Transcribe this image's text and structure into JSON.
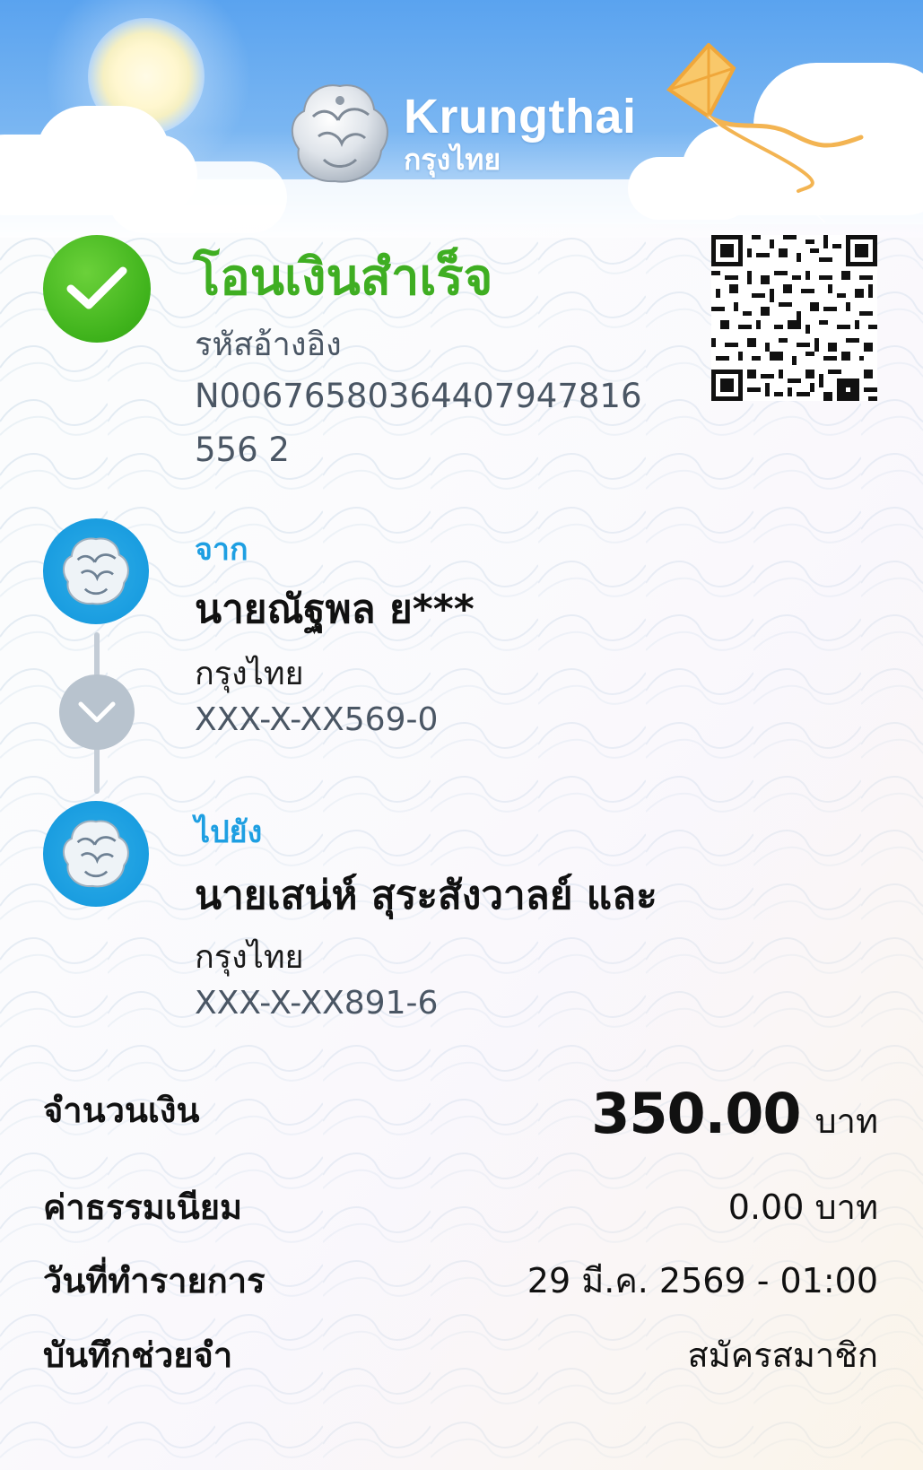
{
  "brand": {
    "name_en": "Krungthai",
    "name_th": "กรุงไทย"
  },
  "status": {
    "title": "โอนเงินสำเร็จ",
    "ref_label": "รหัสอ้างอิง",
    "ref_value": "N00676580364407947816556 2"
  },
  "from": {
    "tag": "จาก",
    "name": "นายณัฐพล ย***",
    "bank": "กรุงไทย",
    "account": "XXX-X-XX569-0"
  },
  "to": {
    "tag": "ไปยัง",
    "name": "นายเสน่ห์ สุระสังวาลย์ และ",
    "bank": "กรุงไทย",
    "account": "XXX-X-XX891-6"
  },
  "details": {
    "amount_label": "จำนวนเงิน",
    "amount_value": "350.00",
    "amount_unit": "บาท",
    "fee_label": "ค่าธรรมเนียม",
    "fee_value": "0.00 บาท",
    "date_label": "วันที่ทำรายการ",
    "date_value": "29 มี.ค. 2569 - 01:00",
    "memo_label": "บันทึกช่วยจำ",
    "memo_value": "สมัครสมาชิก"
  },
  "icons": {
    "success": "check-icon",
    "bank": "krungthai-bird-icon",
    "direction": "chevron-down-icon",
    "qr": "qr-code-icon"
  },
  "colors": {
    "success_green": "#3fae22",
    "accent_blue": "#1e9fe2",
    "header_blue": "#5aa3ef",
    "muted_text": "#4a5664"
  }
}
